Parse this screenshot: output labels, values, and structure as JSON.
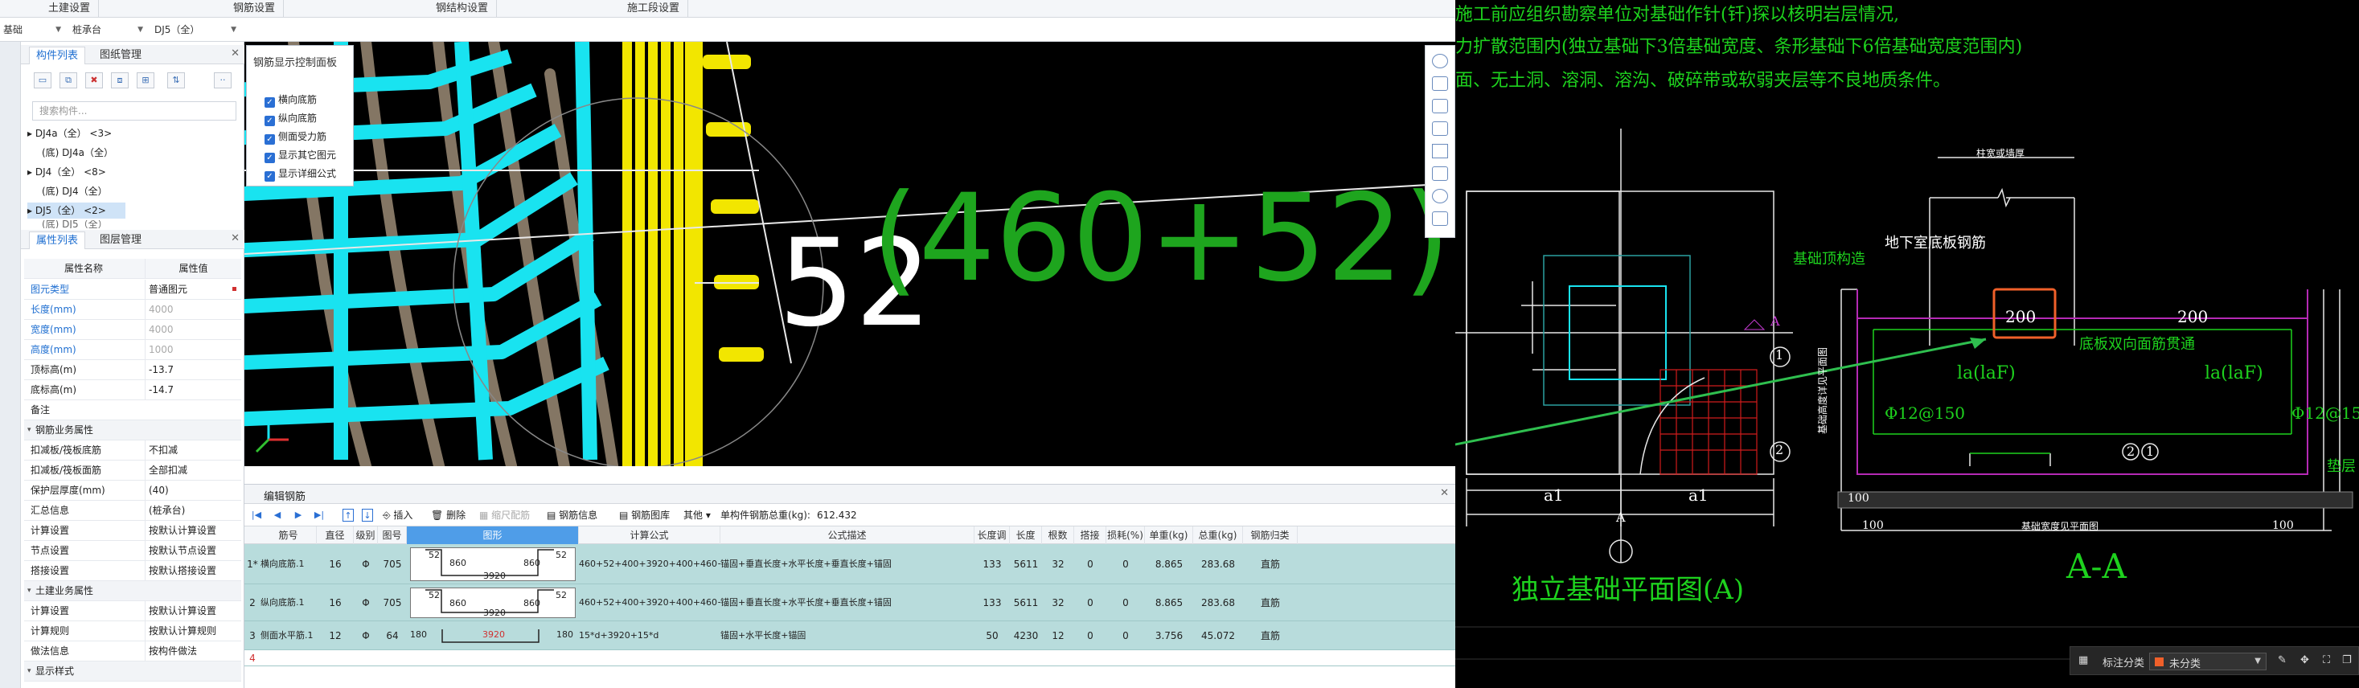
{
  "top_menu": [
    "土建设置",
    "钢筋设置",
    "钢结构设置",
    "施工段设置"
  ],
  "toolbar2": {
    "combo1": "基础",
    "combo2": "桩承台",
    "combo3": "DJ5（全）"
  },
  "component_panel": {
    "tabs": [
      "构件列表",
      "图纸管理"
    ],
    "search_placeholder": "搜索构件...",
    "tree": [
      {
        "label": "DJ4a（全） <3>",
        "level": 0
      },
      {
        "label": "(底) DJ4a（全）",
        "level": 1
      },
      {
        "label": "DJ4（全） <8>",
        "level": 0
      },
      {
        "label": "(底) DJ4（全）",
        "level": 1
      },
      {
        "label": "DJ5（全） <2>",
        "level": 0,
        "selected": true
      },
      {
        "label": "(底) DJ5（全）",
        "level": 1
      }
    ]
  },
  "property_panel": {
    "tabs": [
      "属性列表",
      "图层管理"
    ],
    "col_name": "属性名称",
    "col_value": "属性值",
    "rows": [
      {
        "num": "1",
        "name": "图元类型",
        "value": "普通图元",
        "blue": true,
        "group": false,
        "grey": false
      },
      {
        "num": "2",
        "name": "长度(mm)",
        "value": "4000",
        "blue": true,
        "group": false,
        "grey": true
      },
      {
        "num": "3",
        "name": "宽度(mm)",
        "value": "4000",
        "blue": true,
        "group": false,
        "grey": true
      },
      {
        "num": "4",
        "name": "高度(mm)",
        "value": "1000",
        "blue": true,
        "group": false,
        "grey": true
      },
      {
        "num": "5",
        "name": "顶标高(m)",
        "value": "-13.7",
        "blue": false,
        "group": false,
        "grey": false
      },
      {
        "num": "6",
        "name": "底标高(m)",
        "value": "-14.7",
        "blue": false,
        "group": false,
        "grey": false
      },
      {
        "num": "7",
        "name": "备注",
        "value": "",
        "blue": false,
        "group": false,
        "grey": false
      },
      {
        "num": "8",
        "name": "钢筋业务属性",
        "value": "",
        "blue": false,
        "group": true,
        "grey": false
      },
      {
        "num": "9",
        "name": "扣减板/筏板底筋",
        "value": "不扣减",
        "blue": false,
        "group": false,
        "grey": false
      },
      {
        "num": "10",
        "name": "扣减板/筏板面筋",
        "value": "全部扣减",
        "blue": false,
        "group": false,
        "grey": false
      },
      {
        "num": "11",
        "name": "保护层厚度(mm)",
        "value": "(40)",
        "blue": false,
        "group": false,
        "grey": false
      },
      {
        "num": "12",
        "name": "汇总信息",
        "value": "(桩承台)",
        "blue": false,
        "group": false,
        "grey": false
      },
      {
        "num": "13",
        "name": "计算设置",
        "value": "按默认计算设置",
        "blue": false,
        "group": false,
        "grey": false
      },
      {
        "num": "14",
        "name": "节点设置",
        "value": "按默认节点设置",
        "blue": false,
        "group": false,
        "grey": false
      },
      {
        "num": "15",
        "name": "搭接设置",
        "value": "按默认搭接设置",
        "blue": false,
        "group": false,
        "grey": false
      },
      {
        "num": "16",
        "name": "土建业务属性",
        "value": "",
        "blue": false,
        "group": true,
        "grey": false
      },
      {
        "num": "17",
        "name": "计算设置",
        "value": "按默认计算设置",
        "blue": false,
        "group": false,
        "grey": false
      },
      {
        "num": "18",
        "name": "计算规则",
        "value": "按默认计算规则",
        "blue": false,
        "group": false,
        "grey": false
      },
      {
        "num": "19",
        "name": "做法信息",
        "value": "按构件做法",
        "blue": false,
        "group": false,
        "grey": false
      },
      {
        "num": "20",
        "name": "显示样式",
        "value": "",
        "blue": false,
        "group": true,
        "grey": false
      }
    ]
  },
  "rebar_display_panel": {
    "title": "钢筋显示控制面板",
    "options": [
      "横向底筋",
      "纵向底筋",
      "侧面受力筋",
      "显示其它图元",
      "显示详细公式"
    ]
  },
  "viewport": {
    "label_white": "52",
    "label_green": "(460+52)"
  },
  "editor": {
    "title": "编辑钢筋",
    "tools": [
      "插入",
      "删除",
      "缩尺配筋",
      "钢筋信息",
      "钢筋图库",
      "其他"
    ],
    "total_label": "单构件钢筋总重(kg):",
    "total_value": "612.432",
    "columns": [
      "筋号",
      "直径(mm)",
      "级别",
      "图号",
      "图形",
      "计算公式",
      "公式描述",
      "长度调整",
      "长度",
      "根数",
      "搭接",
      "损耗(%)",
      "单重(kg)",
      "总重(kg)",
      "钢筋归类"
    ],
    "rows": [
      {
        "num": "1*",
        "name": "横向底筋.1",
        "dia": "16",
        "grade": "Φ",
        "fig": "705",
        "shape_left": "52",
        "shape_h1": "860",
        "shape_mid": "3920",
        "shape_h2": "860",
        "shape_right": "52",
        "formula": "460+52+400+3920+400+460+52",
        "desc": "锚固+垂直长度+水平长度+垂直长度+锚固",
        "adj": "",
        "len": "133",
        "len2": "5611",
        "count": "32",
        "lap": "0",
        "loss": "0",
        "unit": "8.865",
        "total": "283.68",
        "cat": "直筋"
      },
      {
        "num": "2",
        "name": "纵向底筋.1",
        "dia": "16",
        "grade": "Φ",
        "fig": "705",
        "shape_left": "52",
        "shape_h1": "860",
        "shape_mid": "3920",
        "shape_h2": "860",
        "shape_right": "52",
        "formula": "460+52+400+3920+400+460+52",
        "desc": "锚固+垂直长度+水平长度+垂直长度+锚固",
        "adj": "",
        "len": "133",
        "len2": "5611",
        "count": "32",
        "lap": "0",
        "loss": "0",
        "unit": "8.865",
        "total": "283.68",
        "cat": "直筋"
      },
      {
        "num": "3",
        "name": "侧面水平筋.1",
        "dia": "12",
        "grade": "Φ",
        "fig": "64",
        "shape_left": "180",
        "shape_h1": "",
        "shape_mid": "3920",
        "shape_h2": "",
        "shape_right": "180",
        "formula": "15*d+3920+15*d",
        "desc": "锚固+水平长度+锚固",
        "adj": "",
        "len": "50",
        "len2": "4230",
        "count": "12",
        "lap": "0",
        "loss": "0",
        "unit": "3.756",
        "total": "45.072",
        "cat": "直筋"
      },
      {
        "num": "4",
        "name": "",
        "dia": "",
        "grade": "",
        "fig": "",
        "shape_left": "",
        "shape_h1": "",
        "shape_mid": "",
        "shape_h2": "",
        "shape_right": "",
        "formula": "",
        "desc": "",
        "adj": "",
        "len": "",
        "len2": "",
        "count": "",
        "lap": "",
        "loss": "",
        "unit": "",
        "total": "",
        "cat": ""
      }
    ]
  },
  "cad": {
    "notes": [
      "施工前应组织勘察单位对基础作针(钎)探以核明岩层情况,",
      "力扩散范围内(独立基础下3倍基础宽度、条形基础下6倍基础宽度范围内)",
      "面、无土洞、溶洞、溶沟、破碎带或软弱夹层等不良地质条件。"
    ],
    "plan_title": "独立基础平面图(A)",
    "section_title": "A-A",
    "labels": {
      "anchor1": "基础顶构造",
      "anchor2": "地下室底板钢筋",
      "top_label": "柱宽或墙厚",
      "dim200_left": "200",
      "dim200_right": "200",
      "bottom_note": "底板双向面筋贯通",
      "la_left": "la(laF)",
      "la_right": "la(laF)",
      "rebar_left": "Φ12@150",
      "rebar_left2": "Φ12@150",
      "rebar_right": "Φ12@150",
      "pad": "垫层",
      "base_width": "基础宽度见平面图",
      "dim100a": "100",
      "dim100b": "100",
      "dim100c": "100",
      "vertical_label": "基础高度详见平面图",
      "a1": "a1",
      "a2": "a1",
      "A": "A",
      "circle1": "1",
      "circle2": "2",
      "circle3": "2",
      "circle4": "1",
      "arrow_A": "A"
    }
  },
  "bottom_bar": {
    "label": "标注分类",
    "selected": "未分类"
  },
  "colors": {
    "cyan": "#19e3f0",
    "yellow": "#f2e600",
    "green_text": "#1ea51e",
    "cad_green": "#1ed21e",
    "arrow": "#2fbf4f",
    "highlight": "#f0602a",
    "row_bg": "#b8dcdc"
  }
}
